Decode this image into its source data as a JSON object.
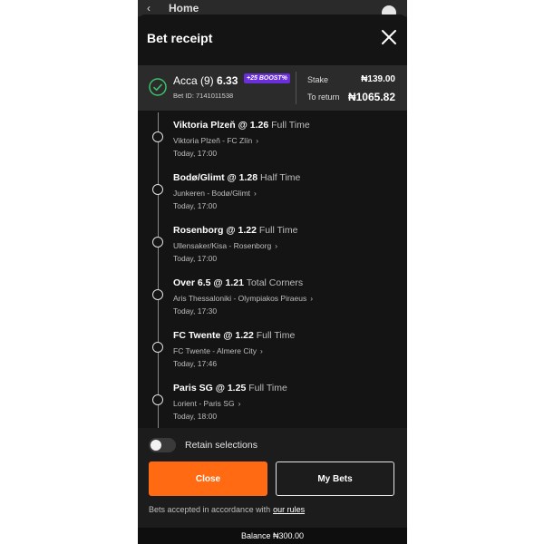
{
  "topbar": {
    "back": "‹",
    "title": "Home"
  },
  "header": {
    "title": "Bet receipt"
  },
  "summary": {
    "bet_type": "Acca (9)",
    "odds": "6.33",
    "boost": "+25 BOOST%",
    "bet_id": "Bet ID: 7141011538",
    "stake_label": "Stake",
    "stake_value": "₦139.00",
    "return_label": "To return",
    "return_value": "₦1065.82"
  },
  "legs": [
    {
      "pick": "Viktoria Plzeň @ 1.26",
      "market": "Full Time",
      "event": "Viktoria Plzeň - FC Zlín",
      "time": "Today, 17:00"
    },
    {
      "pick": "Bodø/Glimt @ 1.28",
      "market": "Half Time",
      "event": "Junkeren - Bodø/Glimt",
      "time": "Today, 17:00"
    },
    {
      "pick": "Rosenborg @ 1.22",
      "market": "Full Time",
      "event": "Ullensaker/Kisa - Rosenborg",
      "time": "Today, 17:00"
    },
    {
      "pick": "Over 6.5 @ 1.21",
      "market": "Total Corners",
      "event": "Aris Thessaloniki - Olympiakos Piraeus",
      "time": "Today, 17:30"
    },
    {
      "pick": "FC Twente @ 1.22",
      "market": "Full Time",
      "event": "FC Twente - Almere City",
      "time": "Today, 17:46"
    },
    {
      "pick": "Paris SG @ 1.25",
      "market": "Full Time",
      "event": "Lorient - Paris SG",
      "time": "Today, 18:00"
    }
  ],
  "footer": {
    "retain_label": "Retain selections",
    "close_label": "Close",
    "mybets_label": "My Bets",
    "accept_text": "Bets accepted in accordance with",
    "rules_link": "our rules",
    "balance": "Balance ₦300.00"
  },
  "colors": {
    "accent": "#ff6a13",
    "boost": "#6a2fd9",
    "success": "#3fbf6b"
  }
}
